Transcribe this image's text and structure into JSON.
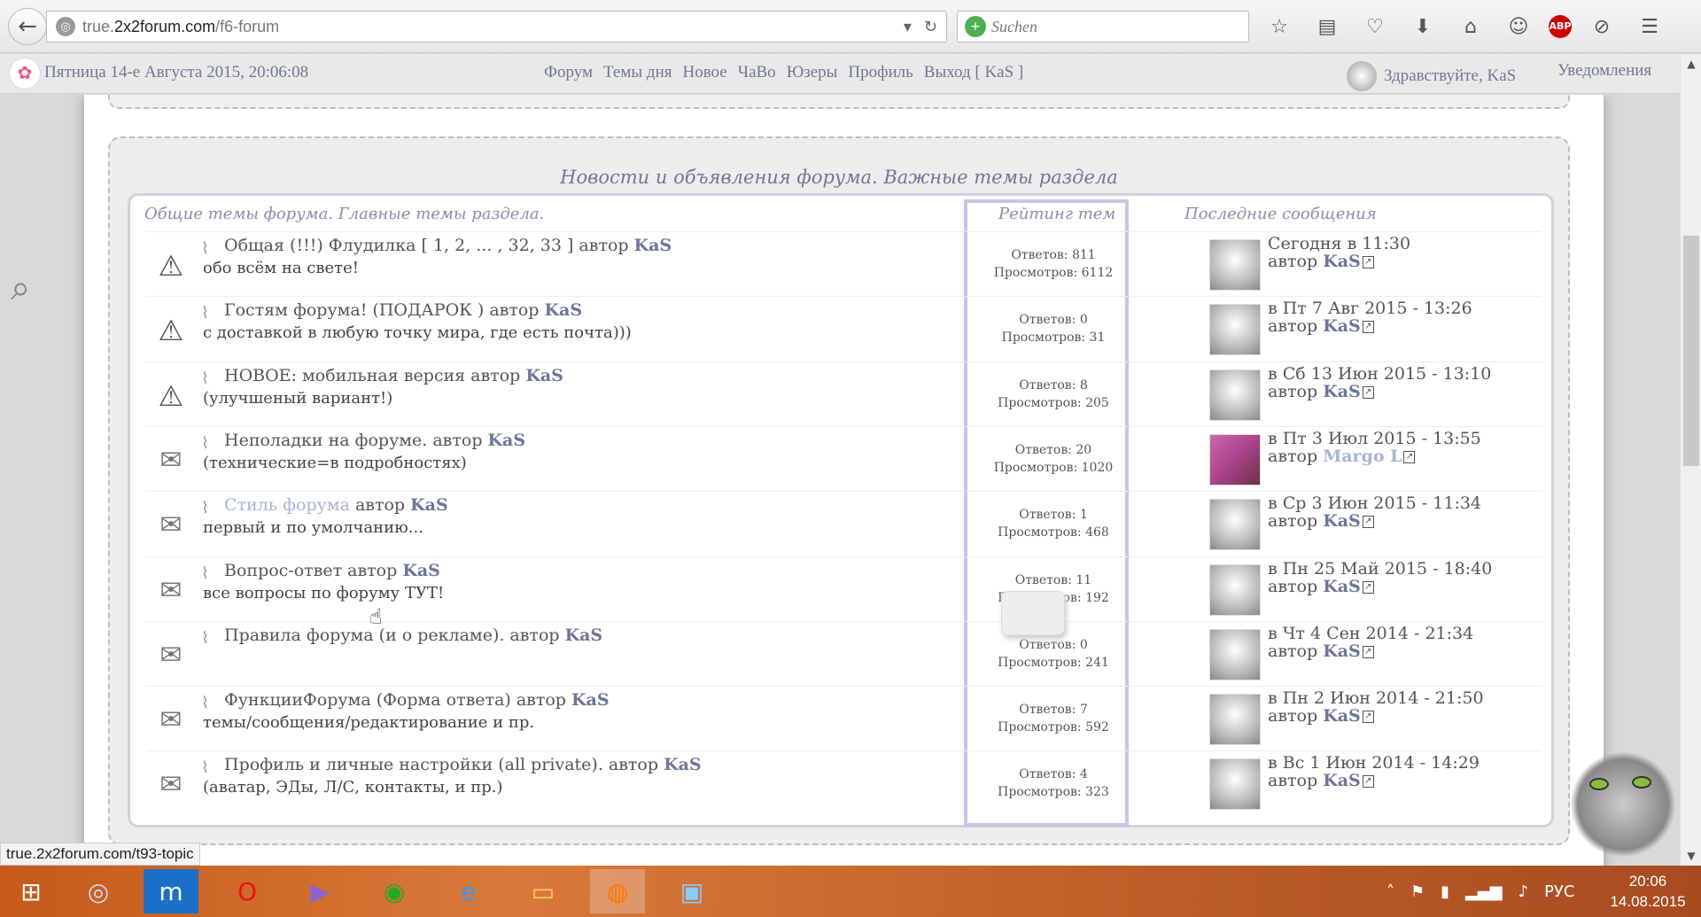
{
  "browser": {
    "url_prefix": "true.",
    "url_domain": "2x2forum.com",
    "url_path": "/f6-forum",
    "search_placeholder": "Suchen"
  },
  "topbar": {
    "datetime": "Пятница 14-е Августа 2015, 20:06:08",
    "nav": [
      "Форум",
      "Темы дня",
      "Новое",
      "ЧаВо",
      "Юзеры",
      "Профиль",
      "Выход [ KaS ]"
    ],
    "greeting": "Здравствуйте, KaS",
    "notifications": "Уведомления"
  },
  "section": {
    "title": "Новости и объявления форума. Важные темы раздела",
    "col_topics": "Общие темы форума. Главные темы раздела.",
    "col_rating": "Рейтинг тем",
    "col_last": "Последние сообщения"
  },
  "author_word": "автор",
  "topics": [
    {
      "icon": "warning",
      "title": "Общая (!!!) Флудилка [ 1, 2, ... , 32, 33 ]",
      "author": "KaS",
      "desc": "обо всём на свете!",
      "replies": "Ответов: 811",
      "views": "Просмотров: 6112",
      "last_date": "Сегодня в 11:30",
      "last_author": "KaS",
      "avatar": "grey"
    },
    {
      "icon": "warning",
      "title": "Гостям форума! (ПОДАРОК )",
      "author": "KaS",
      "desc": "с доставкой в любую точку мира, где есть почта)))",
      "replies": "Ответов: 0",
      "views": "Просмотров: 31",
      "last_date": "в Пт 7 Авг 2015 - 13:26",
      "last_author": "KaS",
      "avatar": "grey"
    },
    {
      "icon": "warning",
      "title": "НОВОЕ: мобильная версия",
      "author": "KaS",
      "desc": "(улучшеный вариант!)",
      "replies": "Ответов: 8",
      "views": "Просмотров: 205",
      "last_date": "в Сб 13 Июн 2015 - 13:10",
      "last_author": "KaS",
      "avatar": "grey"
    },
    {
      "icon": "mail",
      "title": "Неполадки на форуме.",
      "author": "KaS",
      "desc": "(технические=в подробностях)",
      "replies": "Ответов: 20",
      "views": "Просмотров: 1020",
      "last_date": "в Пт 3 Июл 2015 - 13:55",
      "last_author": "Margo L",
      "avatar": "pink"
    },
    {
      "icon": "mail",
      "title": "Стиль форума",
      "author": "KaS",
      "desc": "первый и по умолчанию...",
      "replies": "Ответов: 1",
      "views": "Просмотров: 468",
      "last_date": "в Ср 3 Июн 2015 - 11:34",
      "last_author": "KaS",
      "avatar": "grey"
    },
    {
      "icon": "mail",
      "title": "Вопрос-ответ",
      "author": "KaS",
      "desc": "все вопросы по форуму ТУТ!",
      "replies": "Ответов: 11",
      "views": "Просмотров: 192",
      "last_date": "в Пн 25 Май 2015 - 18:40",
      "last_author": "KaS",
      "avatar": "grey"
    },
    {
      "icon": "mail",
      "title": "Правила форума (и о рекламе).",
      "author": "KaS",
      "desc": "",
      "replies": "Ответов: 0",
      "views": "Просмотров: 241",
      "last_date": "в Чт 4 Сен 2014 - 21:34",
      "last_author": "KaS",
      "avatar": "grey"
    },
    {
      "icon": "mail",
      "title": "ФункцииФорума (Форма ответа)",
      "author": "KaS",
      "desc": "темы/сообщения/редактирование и пр.",
      "replies": "Ответов: 7",
      "views": "Просмотров: 592",
      "last_date": "в Пн 2 Июн 2014 - 21:50",
      "last_author": "KaS",
      "avatar": "grey"
    },
    {
      "icon": "mail",
      "title": "Профиль и личные настройки (all private).",
      "author": "KaS",
      "desc": "(аватар, ЭДы, Л/С, контакты, и пр.)",
      "replies": "Ответов: 4",
      "views": "Просмотров: 323",
      "last_date": "в Вс 1 Июн 2014 - 14:29",
      "last_author": "KaS",
      "avatar": "grey"
    }
  ],
  "status_url": "true.2x2forum.com/t93-topic",
  "taskbar": {
    "lang": "РУС",
    "time": "20:06",
    "date": "14.08.2015"
  }
}
